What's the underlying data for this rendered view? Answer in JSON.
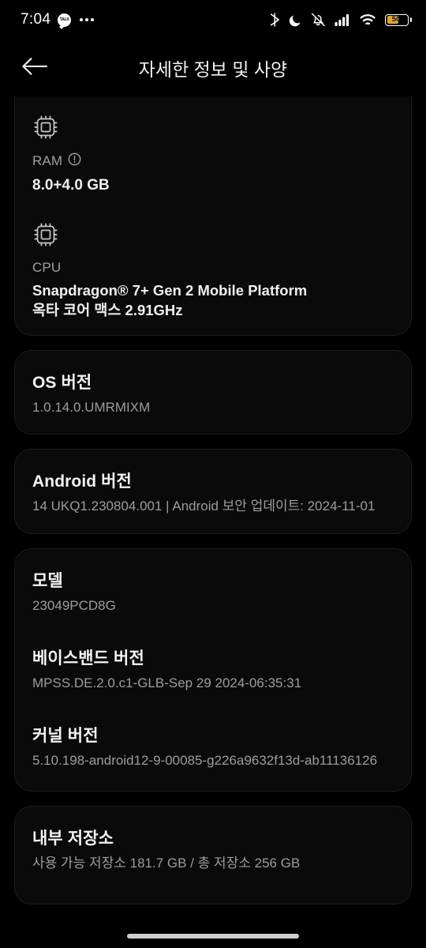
{
  "statusbar": {
    "time": "7:04",
    "notification_icon_label": "TALK",
    "overflow_icon": "more-dots-icon",
    "icons": [
      "bluetooth-icon",
      "do-not-disturb-moon-icon",
      "ringer-muted-icon",
      "cellular-signal-icon",
      "wifi-icon"
    ],
    "battery_level": "50",
    "battery_color": "#e0a23c"
  },
  "appbar": {
    "back_icon": "arrow-left-icon",
    "title": "자세한 정보 및 사양"
  },
  "cards": {
    "hardware": {
      "ram": {
        "icon": "memory-chip-icon",
        "label": "RAM",
        "info_icon": "info-circle-icon",
        "value": "8.0+4.0 GB"
      },
      "cpu": {
        "icon": "cpu-chip-icon",
        "label": "CPU",
        "value_line1": "Snapdragon® 7+ Gen 2 Mobile Platform",
        "value_line2": "옥타 코어 맥스 2.91GHz"
      }
    },
    "os_version": {
      "title": "OS 버전",
      "value": "1.0.14.0.UMRMIXM"
    },
    "android_version": {
      "title": "Android 버전",
      "value": "14 UKQ1.230804.001 | Android 보안 업데이트: 2024-11-01"
    },
    "device_info": {
      "model": {
        "title": "모델",
        "value": "23049PCD8G"
      },
      "baseband": {
        "title": "베이스밴드 버전",
        "value": "MPSS.DE.2.0.c1-GLB-Sep 29 2024-06:35:31"
      },
      "kernel": {
        "title": "커널 버전",
        "value": "5.10.198-android12-9-00085-g226a9632f13d-ab11136126"
      }
    },
    "storage": {
      "title": "내부 저장소",
      "value": "사용 가능 저장소  181.7 GB / 총 저장소  256 GB"
    }
  },
  "navigation": {
    "gesture_pill": "home-gesture-pill"
  }
}
